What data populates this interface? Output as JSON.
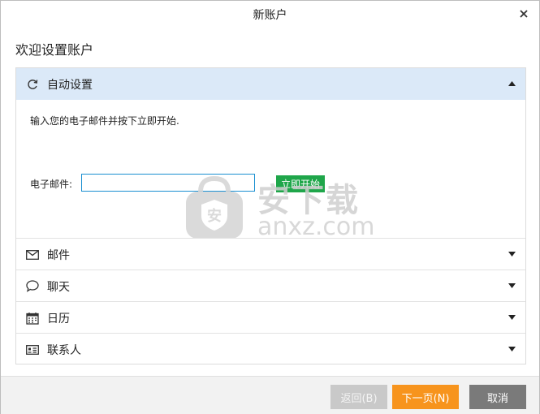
{
  "window": {
    "title": "新账户"
  },
  "heading": "欢迎设置账户",
  "auto_setup": {
    "label": "自动设置",
    "instruction": "输入您的电子邮件并按下立即开始.",
    "email_label": "电子邮件:",
    "email_value": "",
    "start_label": "立即开始"
  },
  "sections": [
    {
      "label": "邮件",
      "icon": "envelope-icon"
    },
    {
      "label": "聊天",
      "icon": "chat-bubble-icon"
    },
    {
      "label": "日历",
      "icon": "calendar-icon"
    },
    {
      "label": "联系人",
      "icon": "contact-card-icon"
    }
  ],
  "watermark": {
    "line1": "安下载",
    "line2": "anxz.com"
  },
  "footer": {
    "back_label": "返回(B)",
    "next_label": "下一页(N)",
    "cancel_label": "取消"
  },
  "colors": {
    "accent_active": "#dbe9f8",
    "start_button": "#1fa64a",
    "next_button": "#f7941d",
    "cancel_button": "#7a7a7a",
    "back_button_disabled": "#c9c9c9"
  }
}
